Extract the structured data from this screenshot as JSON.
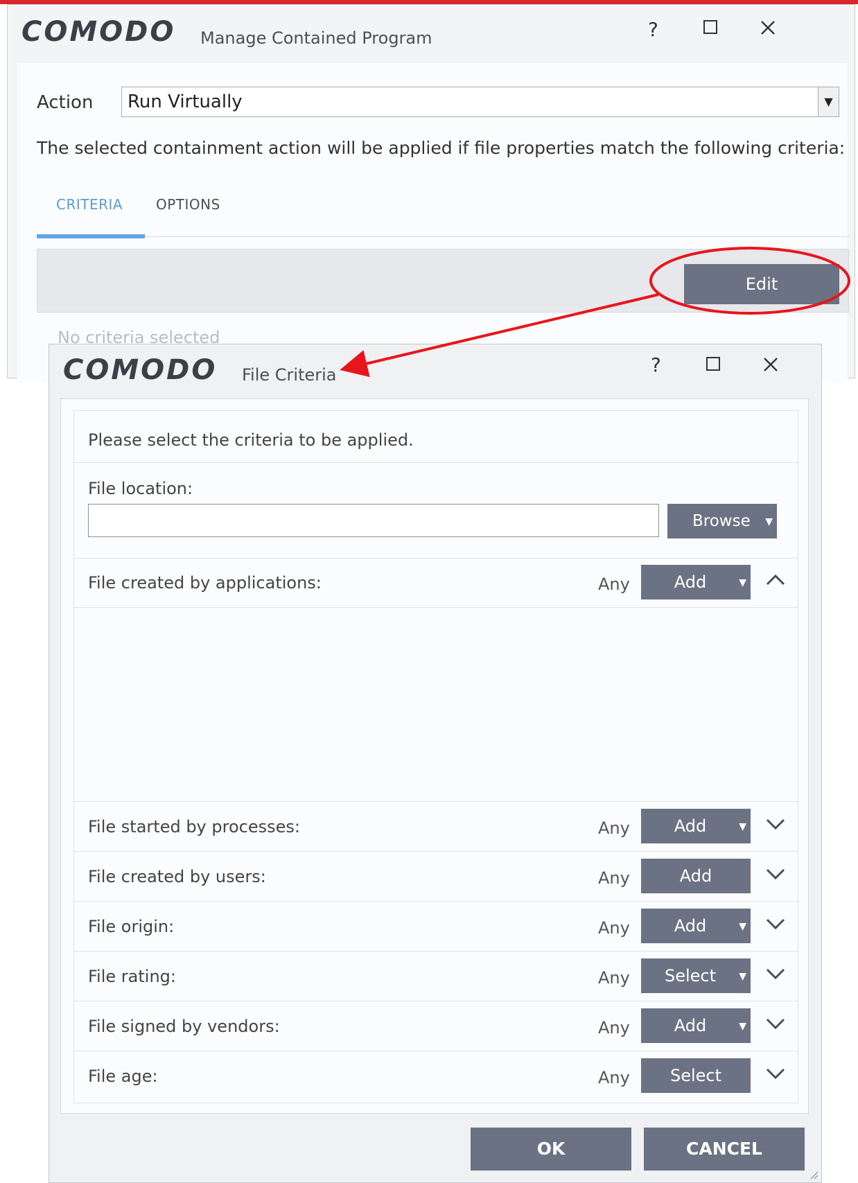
{
  "back_dialog": {
    "logo": "COMODO",
    "title": "Manage Contained Program",
    "help": "?",
    "action_label": "Action",
    "action_value": "Run Virtually",
    "description": "The selected containment action will be applied if file properties match the following criteria:",
    "tabs": [
      {
        "label": "CRITERIA",
        "active": true
      },
      {
        "label": "OPTIONS",
        "active": false
      }
    ],
    "edit_label": "Edit",
    "empty_text": "No criteria selected"
  },
  "front_dialog": {
    "logo": "COMODO",
    "title": "File Criteria",
    "help": "?",
    "intro": "Please select the criteria to be applied.",
    "file_location_label": "File location:",
    "file_location_value": "",
    "browse_label": "Browse",
    "rows": [
      {
        "label": "File created by applications:",
        "value": "Any",
        "button": "Add",
        "dropdown": true,
        "expanded": true
      },
      {
        "label": "File started by processes:",
        "value": "Any",
        "button": "Add",
        "dropdown": true,
        "expanded": false
      },
      {
        "label": "File created by users:",
        "value": "Any",
        "button": "Add",
        "dropdown": false,
        "expanded": false
      },
      {
        "label": "File origin:",
        "value": "Any",
        "button": "Add",
        "dropdown": true,
        "expanded": false
      },
      {
        "label": "File rating:",
        "value": "Any",
        "button": "Select",
        "dropdown": true,
        "expanded": false
      },
      {
        "label": "File signed by vendors:",
        "value": "Any",
        "button": "Add",
        "dropdown": true,
        "expanded": false
      },
      {
        "label": "File age:",
        "value": "Any",
        "button": "Select",
        "dropdown": false,
        "expanded": false
      }
    ],
    "ok_label": "OK",
    "cancel_label": "CANCEL"
  },
  "colors": {
    "accent_tab": "#5b9bd5",
    "button_bg": "#6a7283",
    "callout_red": "#e8161b",
    "top_bar": "#d7262c"
  }
}
